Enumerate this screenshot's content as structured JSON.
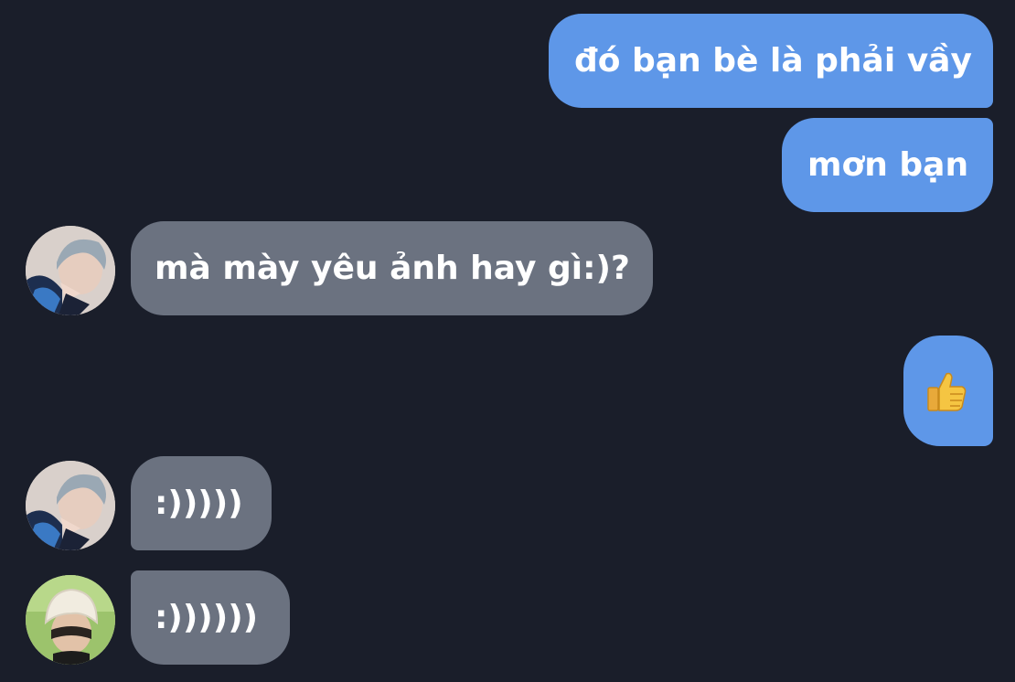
{
  "messages": [
    {
      "id": "m1",
      "direction": "sent",
      "text": "đó bạn bè là phải vầy"
    },
    {
      "id": "m2",
      "direction": "sent",
      "text": "mơn bạn"
    },
    {
      "id": "m3",
      "direction": "received",
      "text": "mà mày yêu ảnh hay gì:)?"
    },
    {
      "id": "m4",
      "direction": "sent",
      "icon": "thumbs-up-icon"
    },
    {
      "id": "m5",
      "direction": "received",
      "text": ":)))))"
    },
    {
      "id": "m6",
      "direction": "received",
      "text": ":))))))"
    }
  ],
  "colors": {
    "background": "#1a1e2a",
    "sent_bubble": "#5e97e8",
    "received_bubble": "#6b7280",
    "text": "#ffffff"
  }
}
